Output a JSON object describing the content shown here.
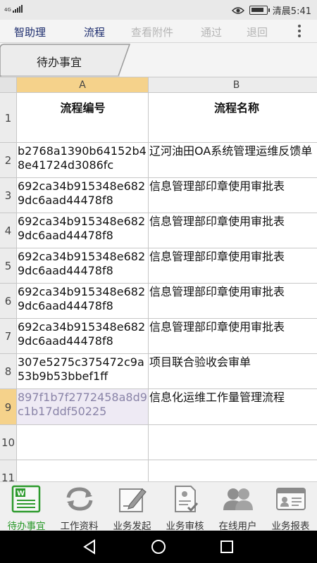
{
  "status_bar": {
    "network": "4G",
    "time": "清晨5:41",
    "battery_level": 0.85
  },
  "toolbar": {
    "app": "智助理",
    "items": [
      "流程",
      "查看附件",
      "通过",
      "退回"
    ]
  },
  "sheet_tab": "待办事宜",
  "columns": [
    "A",
    "B"
  ],
  "rows": [
    {
      "num": "1",
      "a": "流程编号",
      "b": "流程名称"
    },
    {
      "num": "2",
      "a": "b2768a1390b64152b48e41724d3086fc",
      "b": "辽河油田OA系统管理运维反馈单"
    },
    {
      "num": "3",
      "a": "692ca34b915348e6829dc6aad44478f8",
      "b": "信息管理部印章使用审批表"
    },
    {
      "num": "4",
      "a": "692ca34b915348e6829dc6aad44478f8",
      "b": "信息管理部印章使用审批表"
    },
    {
      "num": "5",
      "a": "692ca34b915348e6829dc6aad44478f8",
      "b": "信息管理部印章使用审批表"
    },
    {
      "num": "6",
      "a": "692ca34b915348e6829dc6aad44478f8",
      "b": "信息管理部印章使用审批表"
    },
    {
      "num": "7",
      "a": "692ca34b915348e6829dc6aad44478f8",
      "b": "信息管理部印章使用审批表"
    },
    {
      "num": "8",
      "a": "307e5275c375472c9a53b9b53bbef1ff",
      "b": "项目联合验收会审单"
    },
    {
      "num": "9",
      "a": "897f1b7f2772458a8d9c1b17ddf50225",
      "b": "信息化运维工作量管理流程"
    },
    {
      "num": "10",
      "a": "",
      "b": ""
    },
    {
      "num": "11",
      "a": "",
      "b": ""
    }
  ],
  "bottom_nav": [
    {
      "label": "待办事宜",
      "icon": "todo-document-icon"
    },
    {
      "label": "工作资料",
      "icon": "refresh-arrows-icon"
    },
    {
      "label": "业务发起",
      "icon": "edit-pencil-icon"
    },
    {
      "label": "业务审核",
      "icon": "review-document-check-icon"
    },
    {
      "label": "在线用户",
      "icon": "users-icon"
    },
    {
      "label": "业务报表",
      "icon": "id-card-report-icon"
    }
  ],
  "colors": {
    "active_tab": "#2c9a2c",
    "toolbar_active": "#1a2a6c",
    "toolbar_disabled": "#b5b5b5",
    "selection_highlight": "#f5d28b"
  }
}
